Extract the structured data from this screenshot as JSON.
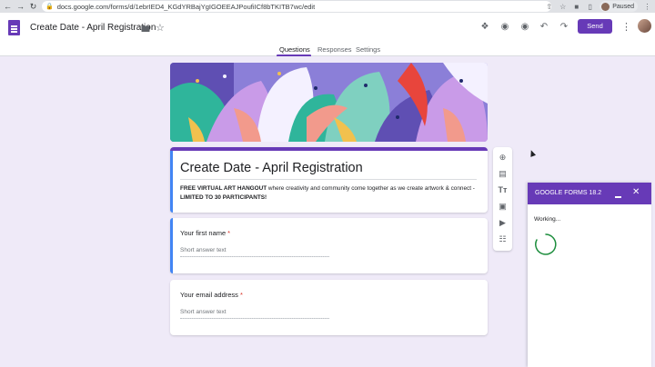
{
  "browser": {
    "url": "docs.google.com/forms/d/1ebrIED4_KGdYRBajYgIGOEEAJPoufiICf8bTKITB7wc/edit",
    "profile_status": "Paused"
  },
  "header": {
    "doc_title": "Create Date - April Registration",
    "send_label": "Send",
    "tabs": [
      {
        "label": "Questions",
        "active": true
      },
      {
        "label": "Responses",
        "active": false
      },
      {
        "label": "Settings",
        "active": false
      }
    ]
  },
  "form": {
    "title": "Create Date - April Registration",
    "description_bold_1": "FREE VIRTUAL ART HANGOUT",
    "description_text": " where creativity and community come together as we create artwork & connect - ",
    "description_bold_2": "LIMITED TO 30 PARTICIPANTS!",
    "questions": [
      {
        "label": "Your first name",
        "required_mark": "*",
        "placeholder": "Short answer text"
      },
      {
        "label": "Your email address",
        "required_mark": "*",
        "placeholder": "Short answer text"
      }
    ]
  },
  "toolbar": {
    "items": [
      "add-question-icon",
      "import-questions-icon",
      "add-title-icon",
      "add-image-icon",
      "add-video-icon",
      "add-section-icon"
    ]
  },
  "panel": {
    "title": "GOOGLE FORMS 18.2",
    "status": "Working..."
  },
  "colors": {
    "accent": "#673ab7",
    "focus": "#4285f4",
    "background": "#efeaf8",
    "required": "#d93025",
    "spinner": "#1e8e3e"
  }
}
